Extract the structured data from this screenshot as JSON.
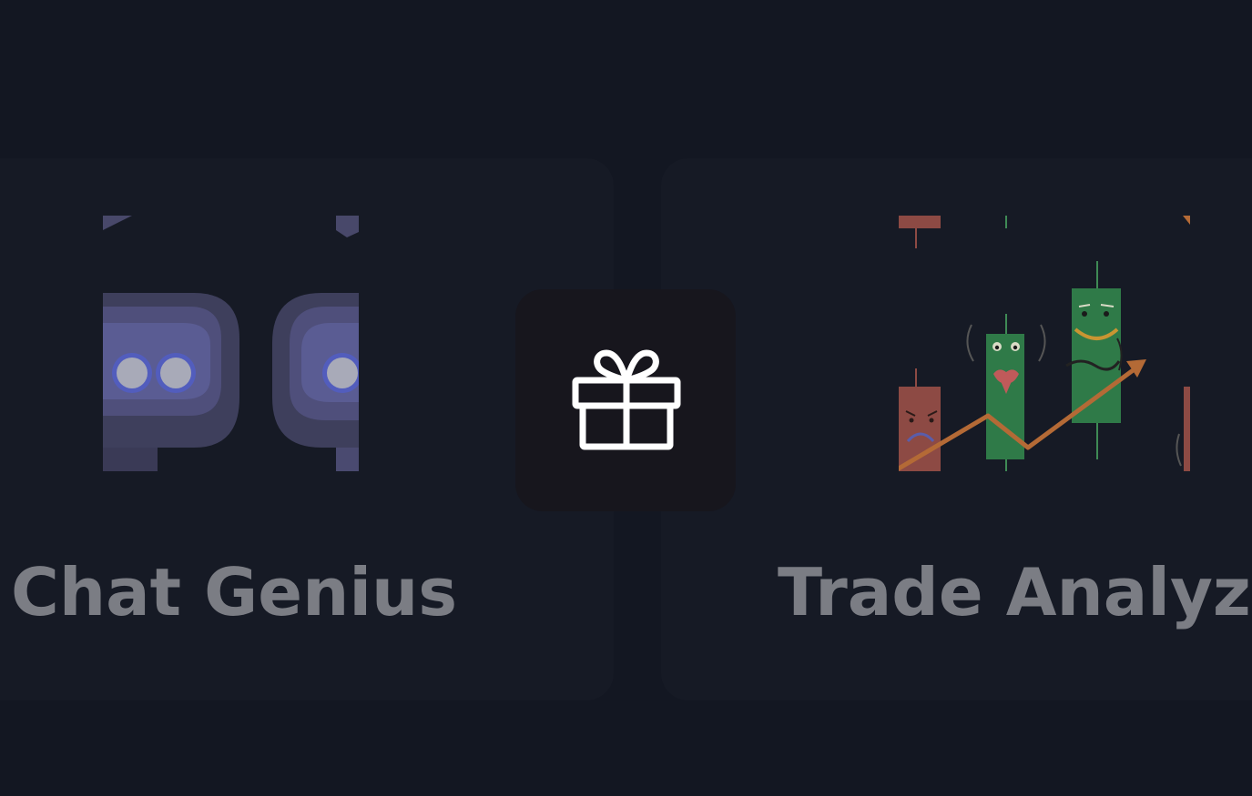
{
  "cards": [
    {
      "title": "Chat Genius",
      "art_icon": "chat-bubbles-icon"
    },
    {
      "title": "Trade Analyzer",
      "art_icon": "candlestick-chart-icon"
    }
  ],
  "center_button": {
    "icon": "gift-icon"
  },
  "colors": {
    "background": "#131722",
    "card_background": "#161a25",
    "title_text": "#7b7d84",
    "gift_badge_background": "#17161d",
    "gift_icon": "#ffffff"
  }
}
